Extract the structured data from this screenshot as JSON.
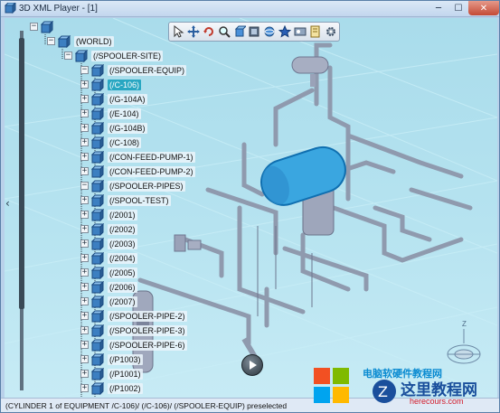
{
  "window": {
    "title": "3D XML Player - [1]",
    "minimize_glyph": "─",
    "maximize_glyph": "☐",
    "close_glyph": "✕"
  },
  "toolbar": {
    "icons": [
      "select-arrow-icon",
      "pan-icon",
      "rotate-icon",
      "zoom-icon",
      "fit-all-icon",
      "view-icon",
      "render-mode-icon",
      "star-icon",
      "scene-icon",
      "search-icon",
      "settings-icon"
    ]
  },
  "tree": {
    "collapse_glyph": "‹",
    "nodes": [
      {
        "label": "",
        "exp": "−",
        "level": 0
      },
      {
        "label": "(WORLD)",
        "exp": "−",
        "level": 1
      },
      {
        "label": "(/SPOOLER-SITE)",
        "exp": "−",
        "level": 2
      },
      {
        "label": "(/SPOOLER-EQUIP)",
        "exp": "−",
        "level": 3
      },
      {
        "label": "(/C-106)",
        "exp": "+",
        "level": 4,
        "selected": true
      },
      {
        "label": "(/G-104A)",
        "exp": "+",
        "level": 4
      },
      {
        "label": "(/E-104)",
        "exp": "+",
        "level": 4
      },
      {
        "label": "(/G-104B)",
        "exp": "+",
        "level": 4
      },
      {
        "label": "(/C-108)",
        "exp": "+",
        "level": 4
      },
      {
        "label": "(/CON-FEED-PUMP-1)",
        "exp": "+",
        "level": 4
      },
      {
        "label": "(/CON-FEED-PUMP-2)",
        "exp": "+",
        "level": 4
      },
      {
        "label": "(/SPOOLER-PIPES)",
        "exp": "−",
        "level": 3
      },
      {
        "label": "(/SPOOL-TEST)",
        "exp": "+",
        "level": 4
      },
      {
        "label": "(/2001)",
        "exp": "+",
        "level": 4
      },
      {
        "label": "(/2002)",
        "exp": "+",
        "level": 4
      },
      {
        "label": "(/2003)",
        "exp": "+",
        "level": 4
      },
      {
        "label": "(/2004)",
        "exp": "+",
        "level": 4
      },
      {
        "label": "(/2005)",
        "exp": "+",
        "level": 4
      },
      {
        "label": "(/2006)",
        "exp": "+",
        "level": 4
      },
      {
        "label": "(/2007)",
        "exp": "+",
        "level": 4
      },
      {
        "label": "(/SPOOLER-PIPE-2)",
        "exp": "+",
        "level": 4
      },
      {
        "label": "(/SPOOLER-PIPE-3)",
        "exp": "+",
        "level": 4
      },
      {
        "label": "(/SPOOLER-PIPE-6)",
        "exp": "+",
        "level": 4
      },
      {
        "label": "(/P1003)",
        "exp": "+",
        "level": 4
      },
      {
        "label": "(/P1001)",
        "exp": "+",
        "level": 4
      },
      {
        "label": "(/P1002)",
        "exp": "+",
        "level": 4
      }
    ]
  },
  "status": {
    "text": "(CYLINDER 1 of EQUIPMENT /C-106)/ (/C-106)/ (/SPOOLER-EQUIP) preselected"
  },
  "compass": {
    "axis_label": "Z"
  },
  "watermark": {
    "text": "电脑软硬件教程网",
    "main": "这里教程网",
    "sub": "herecours.com"
  },
  "colors": {
    "viewport_bg": "#b0e0ee",
    "selected_label": "#29a7c2",
    "pipe": "#8f9aae",
    "highlight_vessel": "#3aa6e0"
  }
}
